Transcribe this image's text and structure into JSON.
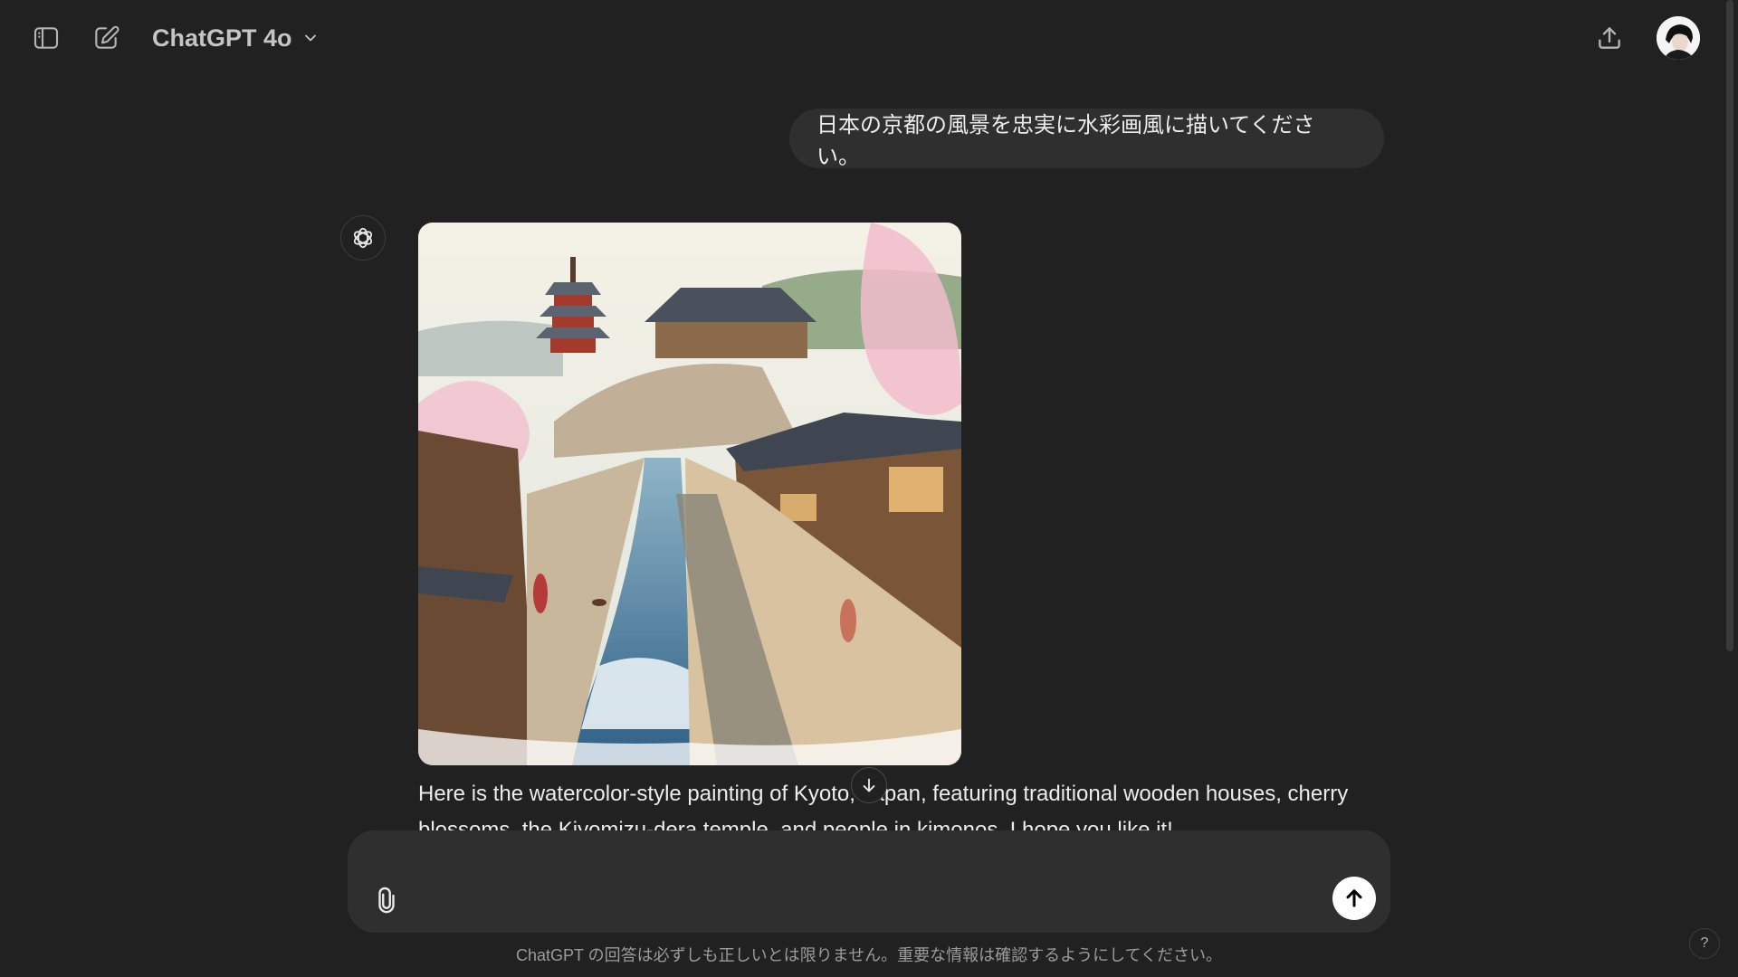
{
  "header": {
    "model_name": "ChatGPT 4o",
    "icons": {
      "sidebar": "sidebar-toggle-icon",
      "new_chat": "new-chat-icon",
      "model_dropdown": "chevron-down-icon",
      "share": "share-icon",
      "avatar": "user-avatar"
    }
  },
  "conversation": {
    "user_message": "日本の京都の風景を忠実に水彩画風に描いてください。",
    "assistant": {
      "icon": "openai-logo-icon",
      "image": "generated-image-kyoto-watercolor",
      "text": "Here is the watercolor-style painting of Kyoto, Japan, featuring traditional wooden houses, cherry blossoms, the Kiyomizu-dera temple, and people in kimonos. I hope you like it!"
    }
  },
  "composer": {
    "placeholder": "",
    "value": "",
    "icons": {
      "attach": "paperclip-icon",
      "send": "arrow-up-icon",
      "scroll_down": "arrow-down-icon"
    }
  },
  "footer": {
    "disclaimer": "ChatGPT の回答は必ずしも正しいとは限りません。重要な情報は確認するようにしてください。",
    "help": "?"
  },
  "colors": {
    "background": "#212121",
    "bubble": "#2f2f2f",
    "text": "#ececec",
    "muted_text": "#9b9b9b",
    "send_button": "#ffffff"
  }
}
